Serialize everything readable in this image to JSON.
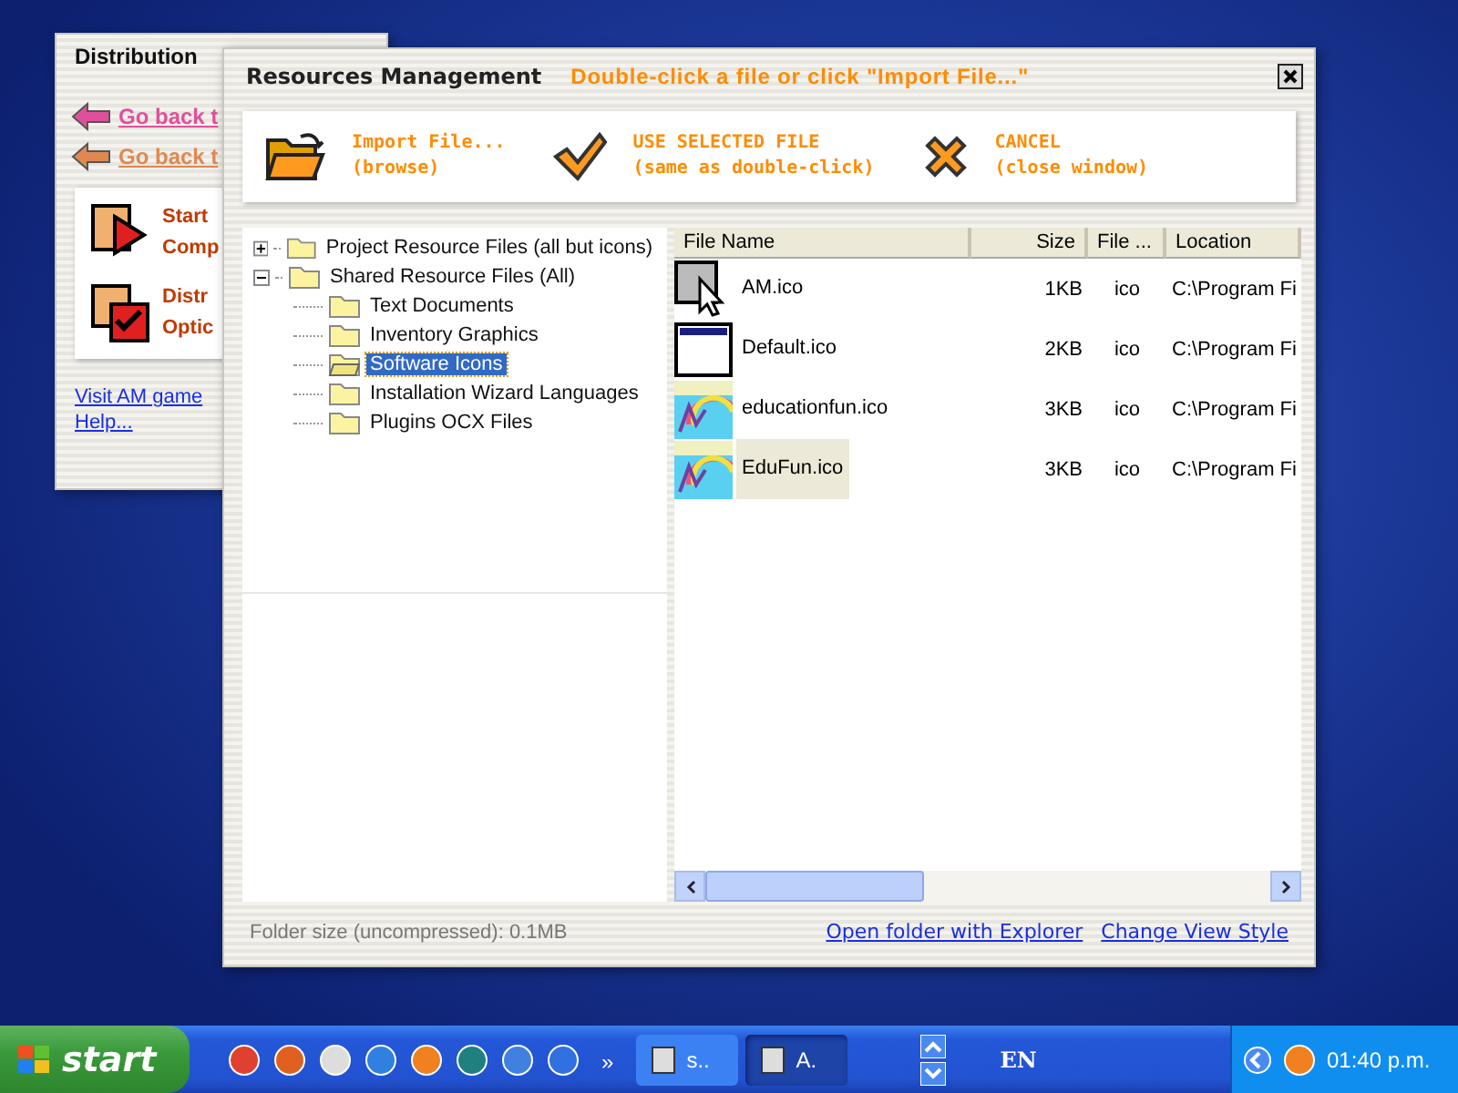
{
  "back_window": {
    "title": "Distribution",
    "links": [
      {
        "text": "Go back t",
        "color": "#e0509a"
      },
      {
        "text": "Go back t",
        "color": "#e08850"
      }
    ],
    "actions": [
      {
        "kind": "start",
        "line1": "Start",
        "line2": "Comp"
      },
      {
        "kind": "distribute",
        "line1": "Distr",
        "line2": "Optic"
      }
    ],
    "footer_links": [
      "Visit AM game",
      "Help..."
    ]
  },
  "window": {
    "title": "Resources Management",
    "hint": "Double-click a file or click \"Import File...\"",
    "toolbar": [
      {
        "kind": "import",
        "line1": "Import File...",
        "line2": "(browse)"
      },
      {
        "kind": "use",
        "line1": "USE SELECTED FILE",
        "line2": "(same as double-click)"
      },
      {
        "kind": "cancel",
        "line1": "CANCEL",
        "line2": "(close window)"
      }
    ],
    "tree": [
      {
        "label": "Project Resource Files (all but icons)",
        "expanded": false,
        "selected": false
      },
      {
        "label": "Shared Resource Files (All)",
        "expanded": true,
        "selected": false,
        "children": [
          {
            "label": "Text Documents",
            "selected": false
          },
          {
            "label": "Inventory Graphics",
            "selected": false
          },
          {
            "label": "Software Icons",
            "selected": true
          },
          {
            "label": "Installation Wizard Languages",
            "selected": false
          },
          {
            "label": "Plugins OCX Files",
            "selected": false
          }
        ]
      }
    ],
    "table": {
      "columns": [
        "File Name",
        "Size",
        "File ...",
        "Location"
      ],
      "rows": [
        {
          "kind": "cursor",
          "name": "AM.ico",
          "size": "1KB",
          "type": "ico",
          "location": "C:\\Program Fi",
          "selected": false
        },
        {
          "kind": "window",
          "name": "Default.ico",
          "size": "2KB",
          "type": "ico",
          "location": "C:\\Program Fi",
          "selected": false
        },
        {
          "kind": "picture",
          "name": "educationfun.ico",
          "size": "3KB",
          "type": "ico",
          "location": "C:\\Program Fi",
          "selected": false
        },
        {
          "kind": "picture",
          "name": "EduFun.ico",
          "size": "3KB",
          "type": "ico",
          "location": "C:\\Program Fi",
          "selected": true
        }
      ]
    },
    "status": "Folder size (uncompressed): 0.1MB",
    "links": [
      "Open folder with Explorer",
      "Change View Style"
    ]
  },
  "taskbar": {
    "start": "start",
    "more": "»",
    "tasks": [
      {
        "label": "s..",
        "selected": false
      },
      {
        "label": "A.",
        "selected": true
      }
    ],
    "language": "EN",
    "clock": "01:40 p.m."
  }
}
